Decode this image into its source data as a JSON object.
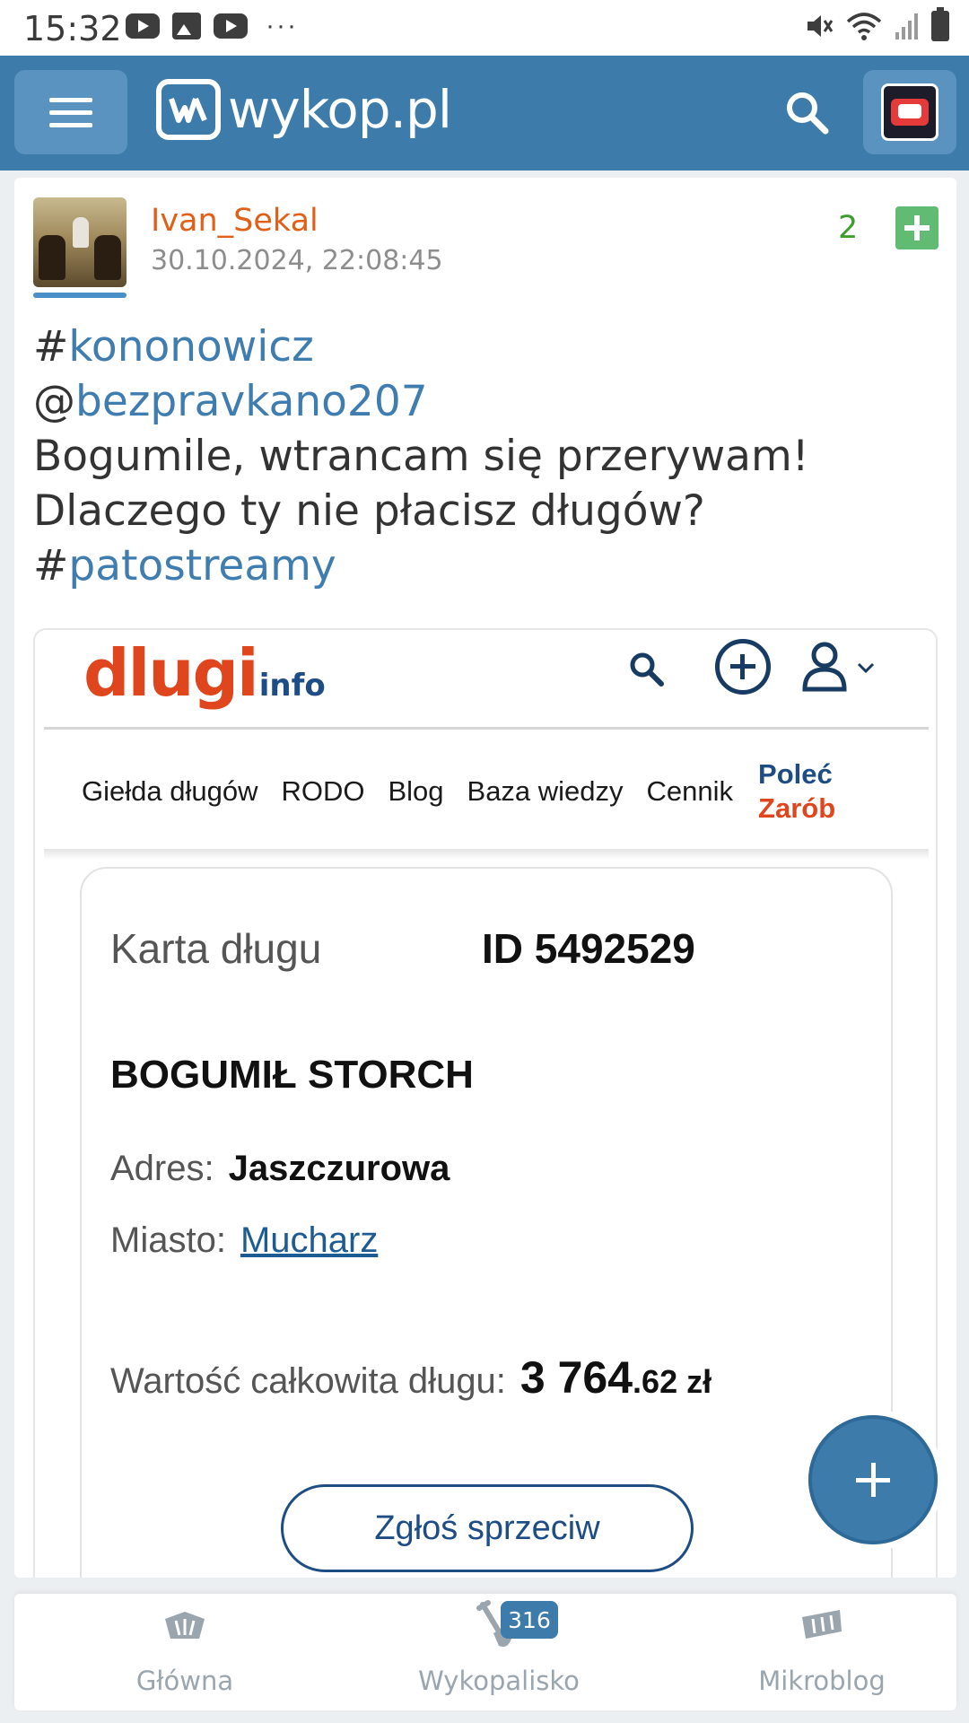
{
  "status_bar": {
    "time": "15:32",
    "dots": "···"
  },
  "topbar": {
    "logo_text": "wykop.pl"
  },
  "post": {
    "author": "Ivan_Sekal",
    "timestamp": "30.10.2024, 22:08:45",
    "votes": "2",
    "body": {
      "tag1_prefix": "#",
      "tag1": "kononowicz",
      "mention_prefix": "@",
      "mention": "bezpravkano207",
      "line3": "Bogumile, wtrancam się przerywam!",
      "line4": "Dlaczego ty nie płacisz długów?",
      "tag2_prefix": "#",
      "tag2": "patostreamy"
    }
  },
  "embed": {
    "logo_main": "dlugi",
    "logo_sub": "info",
    "nav": [
      "Giełda długów",
      "RODO",
      "Blog",
      "Baza wiedzy",
      "Cennik"
    ],
    "nav_promo_top": "Poleć",
    "nav_promo_bottom": "Zarób",
    "card_title": "Karta długu",
    "card_id": "ID 5492529",
    "debtor_name": "BOGUMIŁ STORCH",
    "address_label": "Adres:",
    "address_value": "Jaszczurowa",
    "city_label": "Miasto:",
    "city_value": "Mucharz",
    "total_label": "Wartość całkowita długu:",
    "total_main": "3 764",
    "total_dec": ".62 zł",
    "object_button": "Zgłoś sprzeciw"
  },
  "bottom_nav": {
    "items": [
      {
        "label": "Główna",
        "icon": "wykop-home-icon"
      },
      {
        "label": "Wykopalisko",
        "icon": "shovel-icon"
      },
      {
        "label": "Mikroblog",
        "icon": "mikroblog-icon"
      }
    ],
    "badge": "316"
  },
  "colors": {
    "topbar": "#3d7bab",
    "author": "#e15f17",
    "tag": "#3f7db0",
    "vote_green": "#3f9d2e",
    "dlugi_orange": "#e0461d",
    "dlugi_navy": "#1d4d84"
  }
}
